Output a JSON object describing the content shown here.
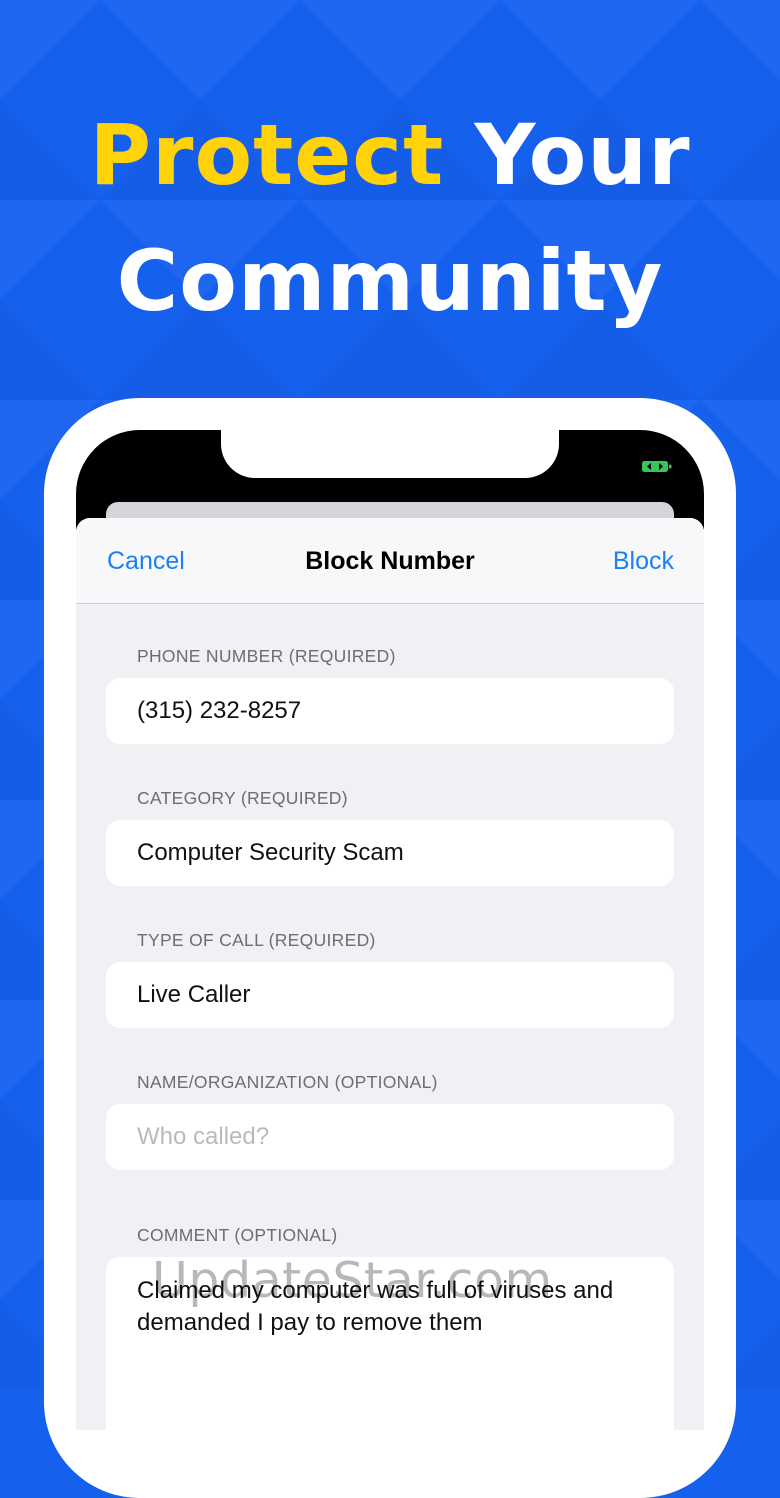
{
  "headline": {
    "line1_accent": "Protect",
    "line1_rest": " Your",
    "line2": "Community",
    "accent_color": "#ffd20a",
    "background_color": "#1660ee"
  },
  "status_bar": {
    "battery_icon": "battery-icon",
    "battery_color": "#34c759"
  },
  "nav": {
    "cancel_label": "Cancel",
    "title": "Block Number",
    "block_label": "Block",
    "tint_color": "#1a82f0"
  },
  "form": {
    "phone": {
      "label": "PHONE NUMBER (REQUIRED)",
      "value": "(315) 232-8257"
    },
    "category": {
      "label": "CATEGORY (REQUIRED)",
      "value": "Computer Security Scam"
    },
    "call_type": {
      "label": "TYPE OF CALL (REQUIRED)",
      "value": "Live Caller"
    },
    "name": {
      "label": "NAME/ORGANIZATION (OPTIONAL)",
      "placeholder": "Who called?"
    },
    "comment": {
      "label": "COMMENT (OPTIONAL)",
      "value": "Claimed my computer was full of viruses and demanded I pay to remove them"
    }
  },
  "watermark": "UpdateStar.com"
}
